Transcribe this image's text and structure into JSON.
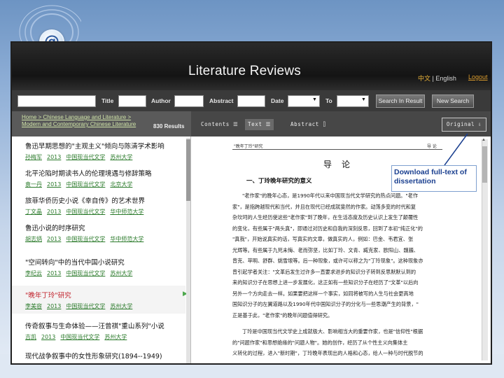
{
  "header": {
    "title": "Literature Reviews",
    "lang_zh": "中文",
    "lang_sep": " | ",
    "lang_en": "English",
    "logout": "Logout"
  },
  "search": {
    "title_label": "Title",
    "author_label": "Author",
    "abstract_label": "Abstract",
    "date_label": "Date",
    "to_label": "To",
    "search_in_result": "Search In Result",
    "new_search": "New Search"
  },
  "results": {
    "breadcrumb": "Home > Chinese Language and Literature > Modern and Contemporary Chinese Literature",
    "count": "830 Results",
    "items": [
      {
        "title": "鲁迅早期思想的\"主观主义\"倾向与陈清学术影响",
        "author": "孙梅军",
        "year": "2013",
        "degree": "中国现当代文学",
        "school": "苏州大学"
      },
      {
        "title": "北平沦陷时期读书人的伦理境遇与修辞策略",
        "author": "袁一丹",
        "year": "2013",
        "degree": "中国现当代文学",
        "school": "北京大学"
      },
      {
        "title": "旅菲华侨历史小说《幸自传》的艺术世界",
        "author": "丁文晶",
        "year": "2013",
        "degree": "中国现当代文学",
        "school": "华中师范大学"
      },
      {
        "title": "鲁迅小说的时序研究",
        "author": "胡志炳",
        "year": "2013",
        "degree": "中国现当代文学",
        "school": "华中师范大学"
      },
      {
        "title": "\"空间转向\"中的当代中国小说研究",
        "author": "李纪云",
        "year": "2013",
        "degree": "中国现当代文学",
        "school": "苏州大学"
      },
      {
        "title": "\"晚年丁玲\"研究",
        "author": "李美容",
        "year": "2013",
        "degree": "中国现当代文学",
        "school": "苏州大学"
      },
      {
        "title": "传奇叙事与生命体验——汪曾祺\"重山系列\"小说",
        "author": "吉凯",
        "year": "2013",
        "degree": "中国现当代文学",
        "school": "苏州大学"
      },
      {
        "title": "现代战争叙事中的女性形象研究(1894--1949)",
        "author": "",
        "year": "",
        "degree": "",
        "school": ""
      }
    ]
  },
  "viewer": {
    "tab_contents": "Contents ☰",
    "tab_text": "Text ☰",
    "tab_abstract": "Abstract ⌷",
    "original": "Original ⇩",
    "header_left": "\"晚年丁玲\"研究",
    "header_right": "导 论",
    "doc_title": "导论",
    "section": "一、丁玲晚年研究的意义",
    "lines": [
      "\"老作家\"的晚年心态，是1990年代以来中国现当代文学研究的热点问题。\"老作",
      "家\"，是指跨越现代和当代，并且在现代已经成就斐然的作家。动荡多变的时代和复",
      "杂坎坷的人生经历使这些\"老作家\"到了晚年，在生活态度及历史认识上发生了颠覆性",
      "的变化，有些属于\"两头真\"，即通过对历史和自我的深刻反思，回到了本初\"纯正化\"的",
      "\"真我\"，开始说真实的话，写真实的文章，做真实的人，例如：巴金、韦君宜、张",
      "光辉等。有些属于九死未悔、老而弥坚，比如丁玲、文青、臧克家、欧阳山、魏巍、",
      "曾克、苹明、舒群、姚雪垠等。后一种现象，或许可以称之为\"丁玲现象\"。这种现象亦",
      "曾引起学者关注：\"文革后发生过许多一直要求进步的知识分子转到反思默默认到的",
      "来的知识分子在思想上进一步发展化，这正如有一些知识分子在经历了\"文革\"以后向",
      "另外一个方向走去一样。如果要把这样一个事实，如同将被写的人生与社会更高地",
      "国知识分子的左翼道路以及1990年代中国知识分子的分化与一些思潮产生的背景，\"",
      "正是基于此，\"老作家\"的晚年问题值得研究。",
      "",
      "丁玲是中国现当代文学史上成就极大、影响相当大的重要作家，也是\"信仰性\"根据",
      "的\"问题作家\"和思想绝缘的\"问题人物\"。她的创作，经历了从个性主义向集体主",
      "义转化的过程，进入\"新时期\"，丁玲晚年表现出的人格和心态，给人一种与时代脱节的"
    ]
  },
  "annotation": {
    "text": "Download full-text of dissertation"
  },
  "colors": {
    "header_bg": "#141414",
    "title_text": "#f4f4f4",
    "accent_orange": "#d89a2d",
    "link_green": "#2a7a2a",
    "selected_red": "#c0202a",
    "annotation_blue": "#1a3f8f"
  }
}
